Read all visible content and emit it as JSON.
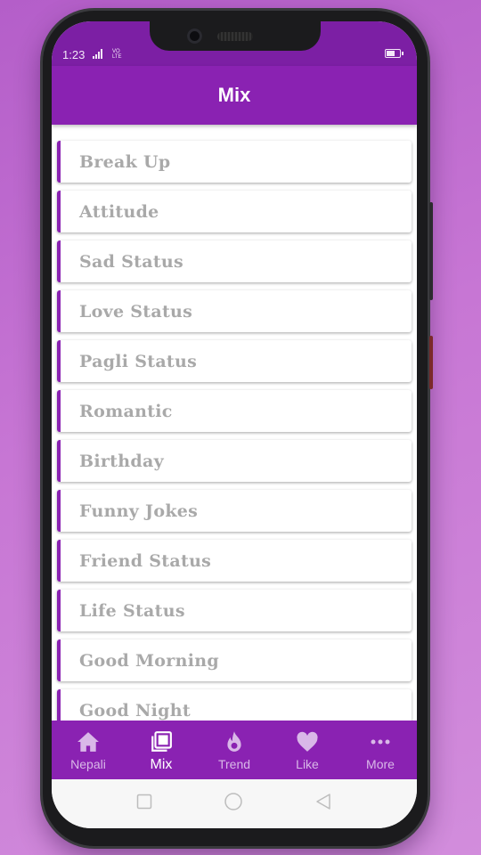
{
  "status_bar": {
    "time": "1:23",
    "network": "VO LTE"
  },
  "app_bar": {
    "title": "Mix"
  },
  "categories": [
    "Break Up",
    "Attitude",
    "Sad Status",
    "Love Status",
    "Pagli Status",
    "Romantic",
    "Birthday",
    "Funny Jokes",
    "Friend Status",
    "Life Status",
    "Good Morning",
    "Good Night"
  ],
  "bottom_nav": [
    {
      "label": "Nepali",
      "icon": "home-icon",
      "active": false
    },
    {
      "label": "Mix",
      "icon": "collections-icon",
      "active": true
    },
    {
      "label": "Trend",
      "icon": "flame-icon",
      "active": false
    },
    {
      "label": "Like",
      "icon": "heart-icon",
      "active": false
    },
    {
      "label": "More",
      "icon": "more-dots-icon",
      "active": false
    }
  ],
  "colors": {
    "primary": "#8a22b2",
    "status_bar": "#7c1fa4",
    "card_text": "#a9a9a9",
    "background": "#c776d4"
  }
}
